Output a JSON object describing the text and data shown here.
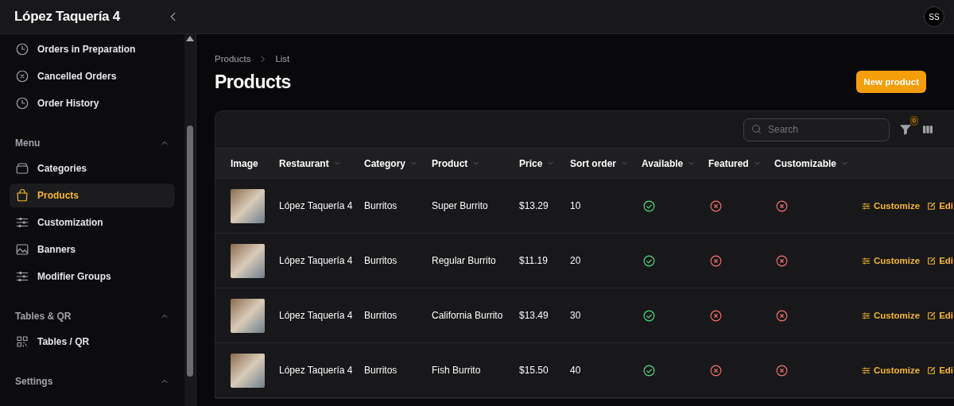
{
  "topbar": {
    "title": "López Taquería 4",
    "avatar": "SS"
  },
  "sidebar": {
    "groups": [
      {
        "items": [
          {
            "label": "Orders in Preparation",
            "selected": false
          },
          {
            "label": "Cancelled Orders",
            "selected": false
          },
          {
            "label": "Order History",
            "selected": false
          }
        ]
      },
      {
        "label": "Menu",
        "expanded": true,
        "items": [
          {
            "label": "Categories",
            "selected": false
          },
          {
            "label": "Products",
            "selected": true
          },
          {
            "label": "Customization",
            "selected": false
          },
          {
            "label": "Banners",
            "selected": false
          },
          {
            "label": "Modifier Groups",
            "selected": false
          }
        ]
      },
      {
        "label": "Tables & QR",
        "expanded": true,
        "items": [
          {
            "label": "Tables / QR",
            "selected": false
          }
        ]
      },
      {
        "label": "Settings",
        "expanded": true
      }
    ]
  },
  "breadcrumbs": [
    "Products",
    "List"
  ],
  "page_title": "Products",
  "new_button": "New product",
  "search": {
    "placeholder": "Search"
  },
  "filter_count": "0",
  "table": {
    "columns": [
      {
        "label": "Image",
        "sortable": false
      },
      {
        "label": "Restaurant",
        "sortable": true
      },
      {
        "label": "Category",
        "sortable": true
      },
      {
        "label": "Product",
        "sortable": true
      },
      {
        "label": "Price",
        "sortable": true
      },
      {
        "label": "Sort order",
        "sortable": true
      },
      {
        "label": "Available",
        "sortable": true
      },
      {
        "label": "Featured",
        "sortable": true
      },
      {
        "label": "Customizable",
        "sortable": true
      }
    ],
    "rows": [
      {
        "restaurant": "López Taquería 4",
        "category": "Burritos",
        "product": "Super Burrito",
        "price": "$13.29",
        "sort_order": "10",
        "available": true,
        "featured": false,
        "customizable": false,
        "actions": [
          "Customize",
          "Edi"
        ]
      },
      {
        "restaurant": "López Taquería 4",
        "category": "Burritos",
        "product": "Regular Burrito",
        "price": "$11.19",
        "sort_order": "20",
        "available": true,
        "featured": false,
        "customizable": false,
        "actions": [
          "Customize",
          "Edi"
        ]
      },
      {
        "restaurant": "López Taquería 4",
        "category": "Burritos",
        "product": "California Burrito",
        "price": "$13.49",
        "sort_order": "30",
        "available": true,
        "featured": false,
        "customizable": false,
        "actions": [
          "Customize",
          "Edi"
        ]
      },
      {
        "restaurant": "López Taquería 4",
        "category": "Burritos",
        "product": "Fish Burrito",
        "price": "$15.50",
        "sort_order": "40",
        "available": true,
        "featured": false,
        "customizable": false,
        "actions": [
          "Customize",
          "Edi"
        ]
      }
    ]
  }
}
